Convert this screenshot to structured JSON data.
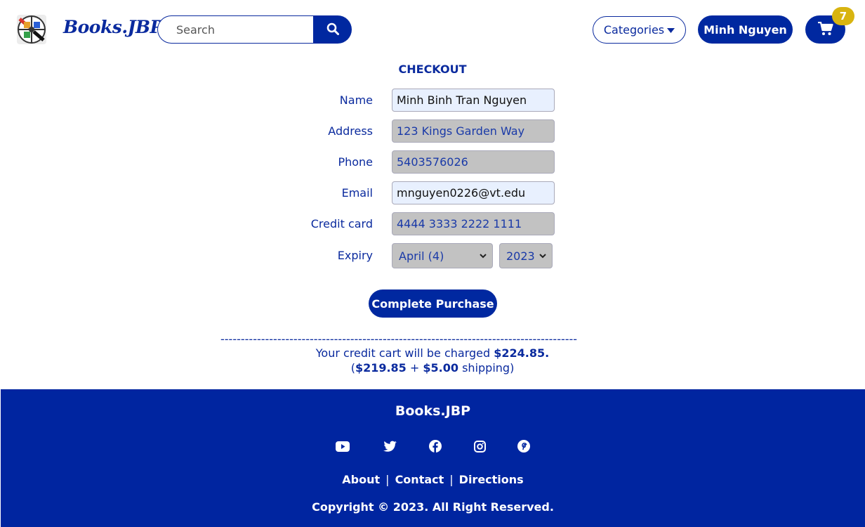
{
  "header": {
    "brand": "Books.JBP",
    "search_placeholder": "Search",
    "categories_label": "Categories",
    "user_label": "Minh Nguyen",
    "cart_count": "7"
  },
  "checkout": {
    "title": "CHECKOUT",
    "name_label": "Name",
    "name_value": "Minh Binh Tran Nguyen",
    "address_label": "Address",
    "address_value": "123 Kings Garden Way",
    "phone_label": "Phone",
    "phone_value": "5403576026",
    "email_label": "Email",
    "email_value": "mnguyen0226@vt.edu",
    "card_label": "Credit card",
    "card_value": "4444 3333 2222 1111",
    "expiry_label": "Expiry",
    "expiry_month": "April (4)",
    "expiry_year": "2023",
    "purchase_label": "Complete Purchase",
    "divider": "----------------------------------------------------------------------------------------",
    "charge_prefix": "Your credit cart will be charged ",
    "charge_total": "$224.85.",
    "subtotal": "$219.85",
    "plus": " + ",
    "shipping_amount": "$5.00",
    "shipping_suffix": " shipping)",
    "open_paren": "("
  },
  "footer": {
    "brand": "Books.JBP",
    "links": [
      "About",
      "Contact",
      "Directions"
    ],
    "copyright": "Copyright © 2023. All Right Reserved.",
    "social_icons": [
      "youtube-icon",
      "twitter-icon",
      "facebook-icon",
      "instagram-icon",
      "pinterest-icon"
    ]
  },
  "colors": {
    "primary": "#0028a0",
    "badge": "#d8b410",
    "invalid_field": "#c2c2c2",
    "valid_field": "#e8f0fe"
  }
}
